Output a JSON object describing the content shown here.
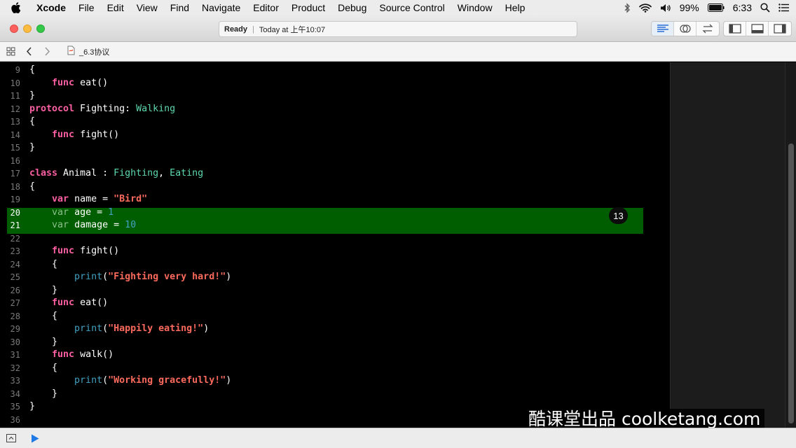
{
  "menubar": {
    "app": "Xcode",
    "items": [
      "File",
      "Edit",
      "View",
      "Find",
      "Navigate",
      "Editor",
      "Product",
      "Debug",
      "Source Control",
      "Window",
      "Help"
    ],
    "battery": "99%",
    "time": "6:33"
  },
  "activity": {
    "status": "Ready",
    "timestamp": "Today at 上午10:07"
  },
  "jumpbar": {
    "file": "_6.3协议"
  },
  "editor": {
    "highlight_badge": "13",
    "lines": [
      {
        "n": "9",
        "html": "{"
      },
      {
        "n": "10",
        "html": "    <span class=\"kw\">func</span> eat()"
      },
      {
        "n": "11",
        "html": "}"
      },
      {
        "n": "12",
        "html": "<span class=\"kw\">protocol</span> Fighting: <span class=\"tp\">Walking</span>"
      },
      {
        "n": "13",
        "html": "{"
      },
      {
        "n": "14",
        "html": "    <span class=\"kw\">func</span> fight()"
      },
      {
        "n": "15",
        "html": "}"
      },
      {
        "n": "16",
        "html": ""
      },
      {
        "n": "17",
        "html": "<span class=\"kw\">class</span> Animal : <span class=\"tp\">Fighting</span>, <span class=\"tp\">Eating</span>"
      },
      {
        "n": "18",
        "html": "{"
      },
      {
        "n": "19",
        "html": "    <span class=\"kw\">var</span> name = <span class=\"str\">\"Bird\"</span>"
      },
      {
        "n": "20",
        "html": "    <span class=\"dim\">var</span> age = <span class=\"num\">1</span>",
        "hl": true
      },
      {
        "n": "21",
        "html": "    <span class=\"dim\">var</span> damage = <span class=\"num\">10</span>",
        "hl": true
      },
      {
        "n": "22",
        "html": ""
      },
      {
        "n": "23",
        "html": "    <span class=\"kw\">func</span> fight()"
      },
      {
        "n": "24",
        "html": "    {"
      },
      {
        "n": "25",
        "html": "        <span class=\"fn\">print</span>(<span class=\"str\">\"Fighting very hard!\"</span>)"
      },
      {
        "n": "26",
        "html": "    }"
      },
      {
        "n": "27",
        "html": "    <span class=\"kw\">func</span> eat()"
      },
      {
        "n": "28",
        "html": "    {"
      },
      {
        "n": "29",
        "html": "        <span class=\"fn\">print</span>(<span class=\"str\">\"Happily eating!\"</span>)"
      },
      {
        "n": "30",
        "html": "    }"
      },
      {
        "n": "31",
        "html": "    <span class=\"kw\">func</span> walk()"
      },
      {
        "n": "32",
        "html": "    {"
      },
      {
        "n": "33",
        "html": "        <span class=\"fn\">print</span>(<span class=\"str\">\"Working gracefully!\"</span>)"
      },
      {
        "n": "34",
        "html": "    }"
      },
      {
        "n": "35",
        "html": "}"
      },
      {
        "n": "36",
        "html": ""
      }
    ]
  },
  "watermark": "酷课堂出品 coolketang.com",
  "colors": {
    "keyword": "#fc5fa3",
    "type": "#5dd8ad",
    "string": "#fc6a5d",
    "number": "#41a1c0",
    "highlight": "#005e00"
  }
}
